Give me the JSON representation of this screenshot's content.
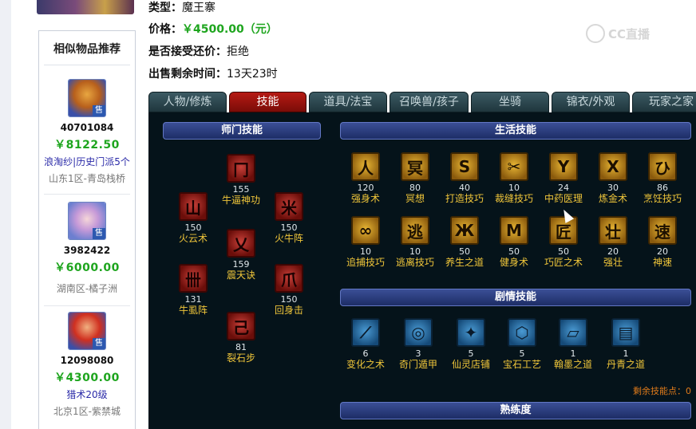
{
  "item": {
    "type_label": "类型：",
    "type_value": "魔王寨",
    "price_label": "价格：",
    "price_value": "￥4500.00（元）",
    "bargain_label": "是否接受还价：",
    "bargain_value": "拒绝",
    "remaining_label": "出售剩余时间：",
    "remaining_value": "13天23时"
  },
  "sidebar": {
    "title": "相似物品推荐",
    "items": [
      {
        "id": "40701084",
        "price": "￥8122.50",
        "desc": "浪淘纱|历史门派5个",
        "server": "山东1区-青岛栈桥",
        "sale_tag": "售",
        "avatar_icon": "demon-king-avatar-icon"
      },
      {
        "id": "3982422",
        "price": "￥6000.00",
        "desc": "",
        "server": "湖南区-橘子洲",
        "sale_tag": "售",
        "avatar_icon": "fairy-girl-avatar-icon"
      },
      {
        "id": "12098080",
        "price": "￥4300.00",
        "desc": "猎术20级",
        "server": "北京1区-紫禁城",
        "sale_tag": "售",
        "avatar_icon": "fire-warrior-avatar-icon"
      }
    ]
  },
  "tabs": [
    "人物/修炼",
    "技能",
    "道具/法宝",
    "召唤兽/孩子",
    "坐骑",
    "锦衣/外观",
    "玩家之家"
  ],
  "active_tab": "技能",
  "sections": {
    "school": "师门技能",
    "life": "生活技能",
    "story": "剧情技能",
    "proficiency": "熟练度"
  },
  "school_skills": [
    {
      "name": "牛逼神功",
      "level": "155"
    },
    {
      "name": "火云术",
      "level": "150"
    },
    {
      "name": "火牛阵",
      "level": "150"
    },
    {
      "name": "震天诀",
      "level": "159"
    },
    {
      "name": "牛虱阵",
      "level": "131"
    },
    {
      "name": "回身击",
      "level": "150"
    },
    {
      "name": "裂石步",
      "level": "81"
    }
  ],
  "life_skills": [
    {
      "name": "强身术",
      "level": "120"
    },
    {
      "name": "冥想",
      "level": "80"
    },
    {
      "name": "打造技巧",
      "level": "40"
    },
    {
      "name": "裁缝技巧",
      "level": "10"
    },
    {
      "name": "中药医理",
      "level": "24"
    },
    {
      "name": "炼金术",
      "level": "30"
    },
    {
      "name": "烹饪技巧",
      "level": "86"
    },
    {
      "name": "追捕技巧",
      "level": "10"
    },
    {
      "name": "逃离技巧",
      "level": "10"
    },
    {
      "name": "养生之道",
      "level": "50"
    },
    {
      "name": "健身术",
      "level": "50"
    },
    {
      "name": "巧匠之术",
      "level": "50"
    },
    {
      "name": "强壮",
      "level": "20"
    },
    {
      "name": "神速",
      "level": "20"
    }
  ],
  "story_skills": [
    {
      "name": "变化之术",
      "level": "6"
    },
    {
      "name": "奇门遁甲",
      "level": "3"
    },
    {
      "name": "仙灵店铺",
      "level": "5"
    },
    {
      "name": "宝石工艺",
      "level": "5"
    },
    {
      "name": "翰墨之道",
      "level": "1"
    },
    {
      "name": "丹青之道",
      "level": "1"
    }
  ],
  "remaining_points": "剩余技能点：0",
  "watermark": "CC直播",
  "colors": {
    "price_green": "#1ea51e",
    "active_tab_red": "#b61a14",
    "skill_name_gold": "#f0c63a",
    "section_header_blue": "#2a3c80",
    "remaining_orange": "#e07b1a"
  }
}
